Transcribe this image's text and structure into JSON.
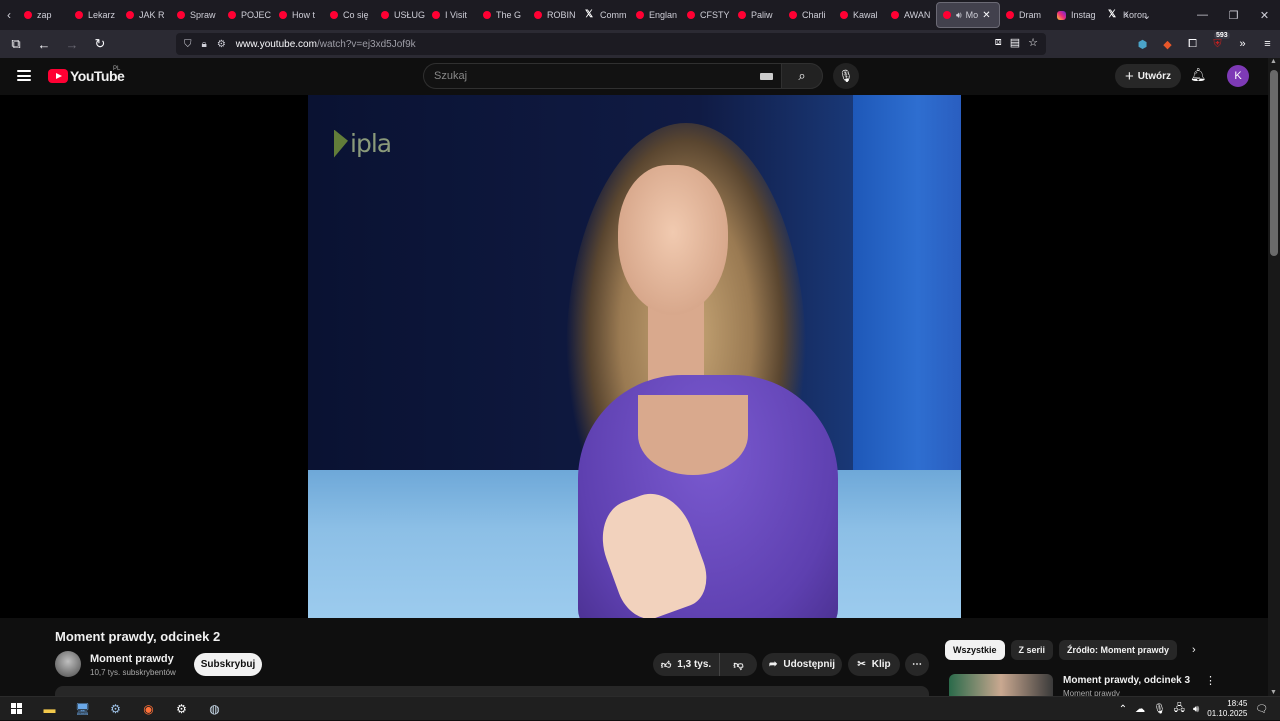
{
  "browser": {
    "tabs": [
      {
        "label": "zap",
        "icon": "youtube-favicon"
      },
      {
        "label": "Lekarz",
        "icon": "youtube-favicon"
      },
      {
        "label": "JAK R",
        "icon": "youtube-favicon"
      },
      {
        "label": "Spraw",
        "icon": "youtube-favicon"
      },
      {
        "label": "POJEC",
        "icon": "youtube-favicon"
      },
      {
        "label": "How t",
        "icon": "youtube-favicon"
      },
      {
        "label": "Co się",
        "icon": "youtube-favicon"
      },
      {
        "label": "USŁUG",
        "icon": "youtube-favicon"
      },
      {
        "label": "I Visit",
        "icon": "youtube-favicon"
      },
      {
        "label": "The G",
        "icon": "youtube-favicon"
      },
      {
        "label": "ROBIN",
        "icon": "youtube-favicon"
      },
      {
        "label": "Comm",
        "icon": "x-favicon"
      },
      {
        "label": "Englan",
        "icon": "youtube-favicon"
      },
      {
        "label": "CFSTY",
        "icon": "youtube-favicon"
      },
      {
        "label": "Paliw",
        "icon": "youtube-favicon"
      },
      {
        "label": "Charli",
        "icon": "youtube-favicon"
      },
      {
        "label": "Kawal",
        "icon": "youtube-favicon"
      },
      {
        "label": "AWAN",
        "icon": "youtube-favicon"
      },
      {
        "label": "Mo",
        "icon": "youtube-favicon",
        "active": true
      },
      {
        "label": "Dram",
        "icon": "youtube-favicon"
      },
      {
        "label": "Instag",
        "icon": "instagram-favicon"
      },
      {
        "label": "Koron",
        "icon": "x-favicon"
      }
    ],
    "url_host": "www.youtube.com",
    "url_path": "/watch?v=ej3xd5Jof9k",
    "extension_badge": "593"
  },
  "youtube": {
    "logo_text": "YouTube",
    "country_code": "PL",
    "search_placeholder": "Szukaj",
    "create_label": "Utwórz",
    "avatar_letter": "K",
    "avatar_color": "#7e3ab6",
    "video_overlay_logo": "ipla",
    "video_title": "Moment prawdy, odcinek 2",
    "channel_name": "Moment prawdy",
    "subscribers": "10,7 tys. subskrybentów",
    "subscribe_label": "Subskrybuj",
    "likes": "1,3 tys.",
    "share_label": "Udostępnij",
    "clip_label": "Klip",
    "chips": [
      "Wszystkie",
      "Z serii",
      "Źródło: Moment prawdy"
    ],
    "recommendation": {
      "title": "Moment prawdy, odcinek 3",
      "channel": "Moment prawdy"
    }
  },
  "taskbar": {
    "time": "18:45",
    "date": "01.10.2025"
  }
}
